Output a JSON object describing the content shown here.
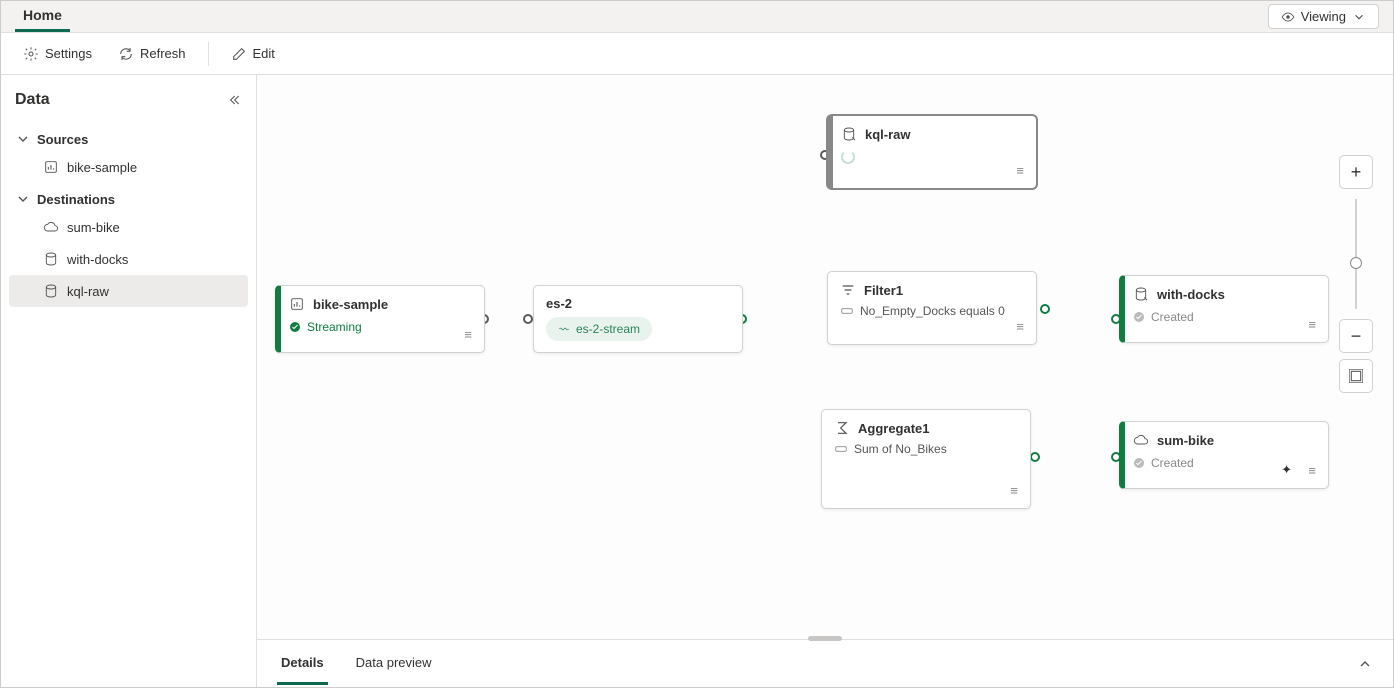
{
  "tabs": {
    "home": "Home"
  },
  "viewing": {
    "label": "Viewing"
  },
  "toolbar": {
    "settings": "Settings",
    "refresh": "Refresh",
    "edit": "Edit"
  },
  "sidebar": {
    "title": "Data",
    "sections": {
      "sources": "Sources",
      "destinations": "Destinations"
    },
    "items": {
      "bike_sample": "bike-sample",
      "sum_bike": "sum-bike",
      "with_docks": "with-docks",
      "kql_raw": "kql-raw"
    }
  },
  "nodes": {
    "bike_sample": {
      "title": "bike-sample",
      "status": "Streaming"
    },
    "es2": {
      "title": "es-2",
      "chip": "es-2-stream"
    },
    "kql_raw": {
      "title": "kql-raw"
    },
    "filter1": {
      "title": "Filter1",
      "sub": "No_Empty_Docks equals 0"
    },
    "aggregate1": {
      "title": "Aggregate1",
      "sub": "Sum of No_Bikes"
    },
    "with_docks": {
      "title": "with-docks",
      "status": "Created"
    },
    "sum_bike": {
      "title": "sum-bike",
      "status": "Created"
    }
  },
  "bottom": {
    "details": "Details",
    "preview": "Data preview"
  },
  "icons": {
    "gear": "gear-icon",
    "refresh": "refresh-icon",
    "edit": "edit-icon",
    "eye": "eye-icon",
    "chevron": "chevron-down-icon",
    "collapse": "collapse-panel-icon",
    "barchart": "barchart-icon",
    "cloud": "cloud-icon",
    "db": "database-icon",
    "filter": "filter-icon",
    "sigma": "sigma-icon",
    "stream": "stream-icon",
    "lines": "lines-menu-icon",
    "check": "check-circle-icon",
    "plus": "plus-icon",
    "minus": "minus-icon",
    "fit": "fit-icon",
    "expand": "chevron-up-icon",
    "sparkle": "sparkle-icon"
  }
}
